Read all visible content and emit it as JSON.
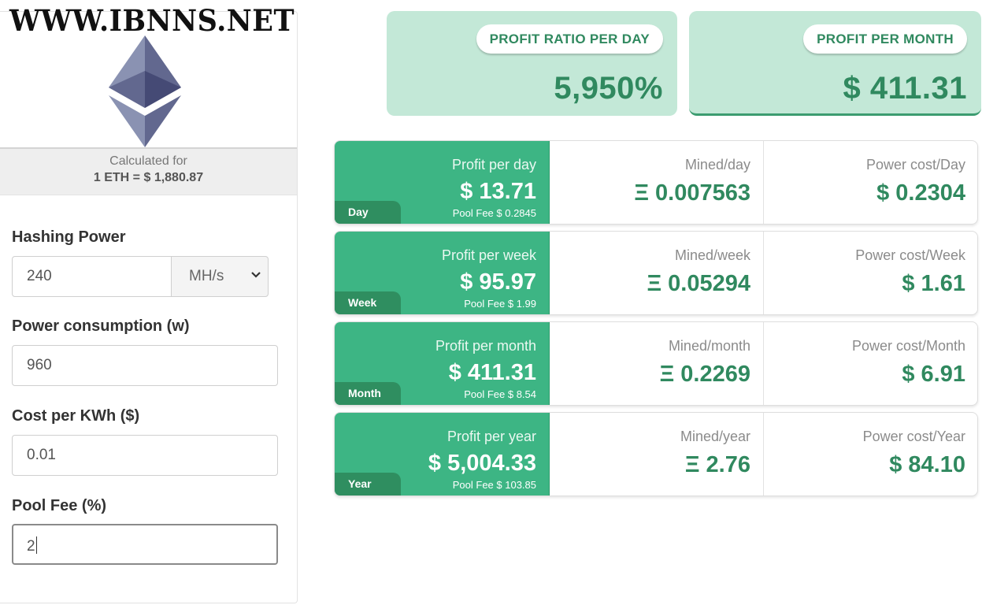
{
  "watermark": "WWW.IBNNS.NET",
  "calc": {
    "line1": "Calculated for",
    "line2": "1 ETH = $ 1,880.87"
  },
  "form": {
    "hashing_label": "Hashing Power",
    "hashing_value": "240",
    "hashing_unit": "MH/s",
    "power_label": "Power consumption (w)",
    "power_value": "960",
    "cost_label": "Cost per KWh ($)",
    "cost_value": "0.01",
    "fee_label": "Pool Fee (%)",
    "fee_value": "2"
  },
  "summary": {
    "ratio_label": "PROFIT RATIO PER DAY",
    "ratio_value": "5,950%",
    "month_label": "PROFIT PER MONTH",
    "month_value": "$ 411.31"
  },
  "rows": [
    {
      "tag": "Day",
      "profit_label": "Profit per day",
      "profit": "$ 13.71",
      "fee": "Pool Fee $ 0.2845",
      "mined_label": "Mined/day",
      "mined": "Ξ 0.007563",
      "power_label": "Power cost/Day",
      "power": "$ 0.2304"
    },
    {
      "tag": "Week",
      "profit_label": "Profit per week",
      "profit": "$ 95.97",
      "fee": "Pool Fee $ 1.99",
      "mined_label": "Mined/week",
      "mined": "Ξ 0.05294",
      "power_label": "Power cost/Week",
      "power": "$ 1.61"
    },
    {
      "tag": "Month",
      "profit_label": "Profit per month",
      "profit": "$ 411.31",
      "fee": "Pool Fee $ 8.54",
      "mined_label": "Mined/month",
      "mined": "Ξ 0.2269",
      "power_label": "Power cost/Month",
      "power": "$ 6.91"
    },
    {
      "tag": "Year",
      "profit_label": "Profit per year",
      "profit": "$ 5,004.33",
      "fee": "Pool Fee $ 103.85",
      "mined_label": "Mined/year",
      "mined": "Ξ 2.76",
      "power_label": "Power cost/Year",
      "power": "$ 84.10"
    }
  ],
  "colors": {
    "accent": "#3db584",
    "accent_dark": "#2f8e60",
    "text_green": "#30895f",
    "summary_bg": "#c3e8d7"
  },
  "icons": {
    "logo": "ethereum-icon",
    "unit_select": "chevron-down-icon"
  }
}
